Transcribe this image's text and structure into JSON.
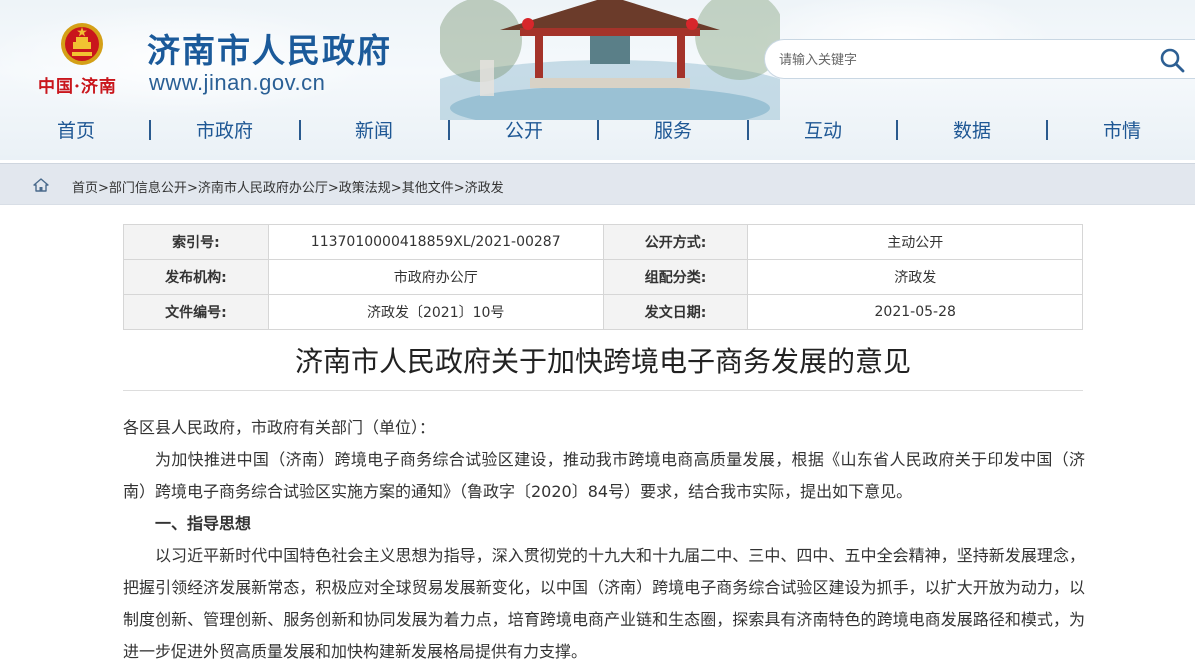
{
  "header": {
    "site_title": "济南市人民政府",
    "site_url": "www.jinan.gov.cn",
    "china_jinan": "中国·济南",
    "search_placeholder": "请输入关键字"
  },
  "nav": {
    "items": [
      "首页",
      "市政府",
      "新闻",
      "公开",
      "服务",
      "互动",
      "数据",
      "市情"
    ]
  },
  "breadcrumb": {
    "items": [
      "首页",
      "部门信息公开",
      "济南市人民政府办公厅",
      "政策法规",
      "其他文件",
      "济政发"
    ],
    "separator": ">"
  },
  "info": {
    "index_label": "索引号:",
    "index_value": "1137010000418859XL/2021-00287",
    "open_mode_label": "公开方式:",
    "open_mode_value": "主动公开",
    "publisher_label": "发布机构:",
    "publisher_value": "市政府办公厅",
    "category_label": "组配分类:",
    "category_value": "济政发",
    "doc_no_label": "文件编号:",
    "doc_no_value": "济政发〔2021〕10号",
    "date_label": "发文日期:",
    "date_value": "2021-05-28"
  },
  "article": {
    "title": "济南市人民政府关于加快跨境电子商务发展的意见",
    "salutation": "各区县人民政府，市政府有关部门（单位）：",
    "para1": "为加快推进中国（济南）跨境电子商务综合试验区建设，推动我市跨境电商高质量发展，根据《山东省人民政府关于印发中国（济南）跨境电子商务综合试验区实施方案的通知》（鲁政字〔2020〕84号）要求，结合我市实际，提出如下意见。",
    "section1_heading": "一、指导思想",
    "para2": "以习近平新时代中国特色社会主义思想为指导，深入贯彻党的十九大和十九届二中、三中、四中、五中全会精神，坚持新发展理念，把握引领经济发展新常态，积极应对全球贸易发展新变化，以中国（济南）跨境电子商务综合试验区建设为抓手，以扩大开放为动力，以制度创新、管理创新、服务创新和协同发展为着力点，培育跨境电商产业链和生态圈，探索具有济南特色的跨境电商发展路径和模式，为进一步促进外贸高质量发展和加快构建新发展格局提供有力支撑。"
  },
  "colors": {
    "brand_blue": "#1b5a9a",
    "emblem_red": "#c9161c",
    "breadcrumb_bg": "#e2e7ee"
  },
  "icons": {
    "search": "search-icon",
    "home": "home-icon",
    "emblem": "national-emblem-icon"
  }
}
